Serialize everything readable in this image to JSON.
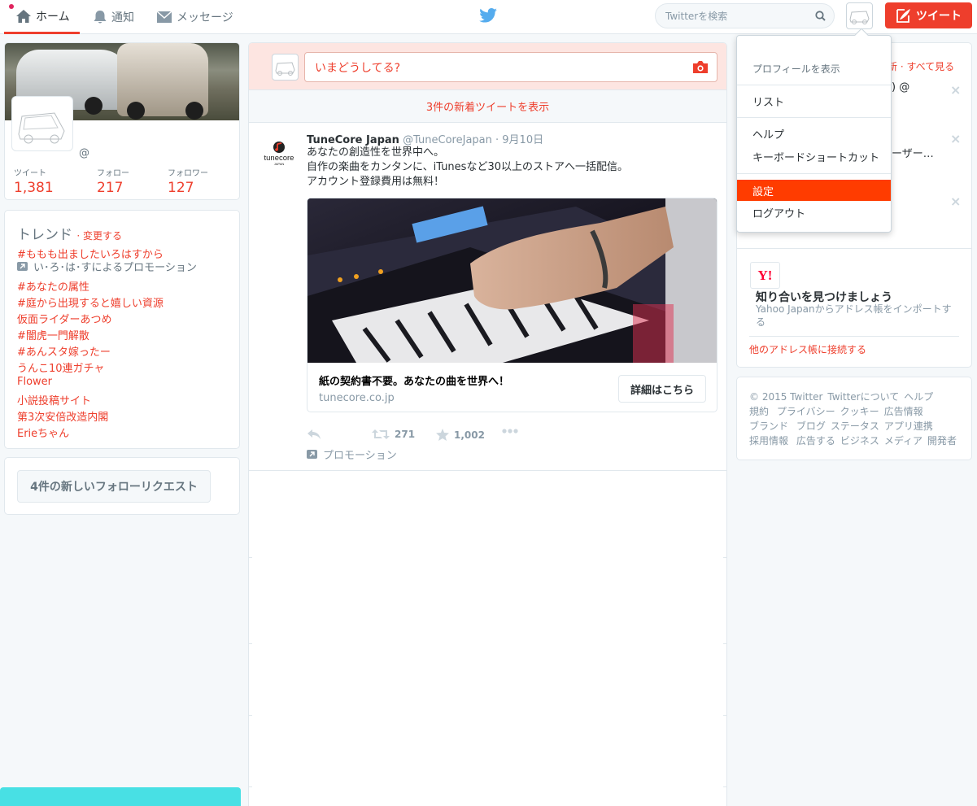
{
  "nav": {
    "home": "ホーム",
    "notifications": "通知",
    "messages": "メッセージ",
    "search_placeholder": "Twitterを検索",
    "tweet_button": "ツイート"
  },
  "colors": {
    "accent": "#ee3e2c",
    "menu_highlight": "#ff3c00",
    "bird": "#55acee",
    "bottom_bar": "#48e0e4"
  },
  "profile": {
    "handle_at": "@",
    "stats": [
      {
        "label": "ツイート",
        "value": "1,381"
      },
      {
        "label": "フォロー",
        "value": "217"
      },
      {
        "label": "フォロワー",
        "value": "127"
      }
    ]
  },
  "trends": {
    "title": "トレンド",
    "change": "· 変更する",
    "items": [
      "#ももも出ましたいろはすから",
      "#あなたの属性",
      "#庭から出現すると嬉しい資源",
      "仮面ライダーあつめ",
      "#闇虎一門解散",
      "#あんスタ嫁ったー",
      "うんこ10連ガチャ",
      "Flower",
      "小説投稿サイト",
      "第3次安倍改造内閣",
      "Erieちゃん"
    ],
    "promoted_by": "い･ろ･は･すによるプロモーション"
  },
  "follow_requests": {
    "button": "4件の新しいフォローリクエスト"
  },
  "timeline": {
    "compose_placeholder": "いまどうしてる?",
    "new_tweets": "3件の新着ツイートを表示",
    "tweet": {
      "name": "TuneCore Japan",
      "handle": "@TuneCoreJapan",
      "date": "· 9月10日",
      "logo_text": "tunecore",
      "logo_sub": "JAPAN",
      "lines": [
        "あなたの創造性を世界中へ。",
        "自作の楽曲をカンタンに、iTunesなど30以上のストアへ一括配信。",
        "アカウント登録費用は無料！"
      ],
      "card": {
        "title": "紙の契約書不要。あなたの曲を世界へ！",
        "domain": "tunecore.co.jp",
        "button": "詳細はこちら"
      },
      "retweets": "271",
      "favorites": "1,002",
      "promoted": "プロモーション"
    }
  },
  "dropdown": {
    "items": [
      "プロフィールを表示",
      "リスト",
      "ヘルプ",
      "キーボードショートカット",
      "設定",
      "ログアウト"
    ]
  },
  "who_to_follow": {
    "header": "新 · すべて見る",
    "fragments": [
      ") @",
      "ーザー…"
    ],
    "yahoo_logo": "Y!",
    "find_title": "知り合いを見つけましょう",
    "find_desc": "Yahoo Japanからアドレス帳をインポートする",
    "find_link": "他のアドレス帳に接続する"
  },
  "footer": {
    "links": [
      "© 2015 Twitter",
      "Twitterについて",
      "ヘルプ",
      "規約",
      "プライバシー",
      "クッキー",
      "広告情報",
      "ブランド",
      "ブログ",
      "ステータス",
      "アプリ連携",
      "採用情報",
      "広告する",
      "ビジネス",
      "メディア",
      "開発者"
    ]
  }
}
